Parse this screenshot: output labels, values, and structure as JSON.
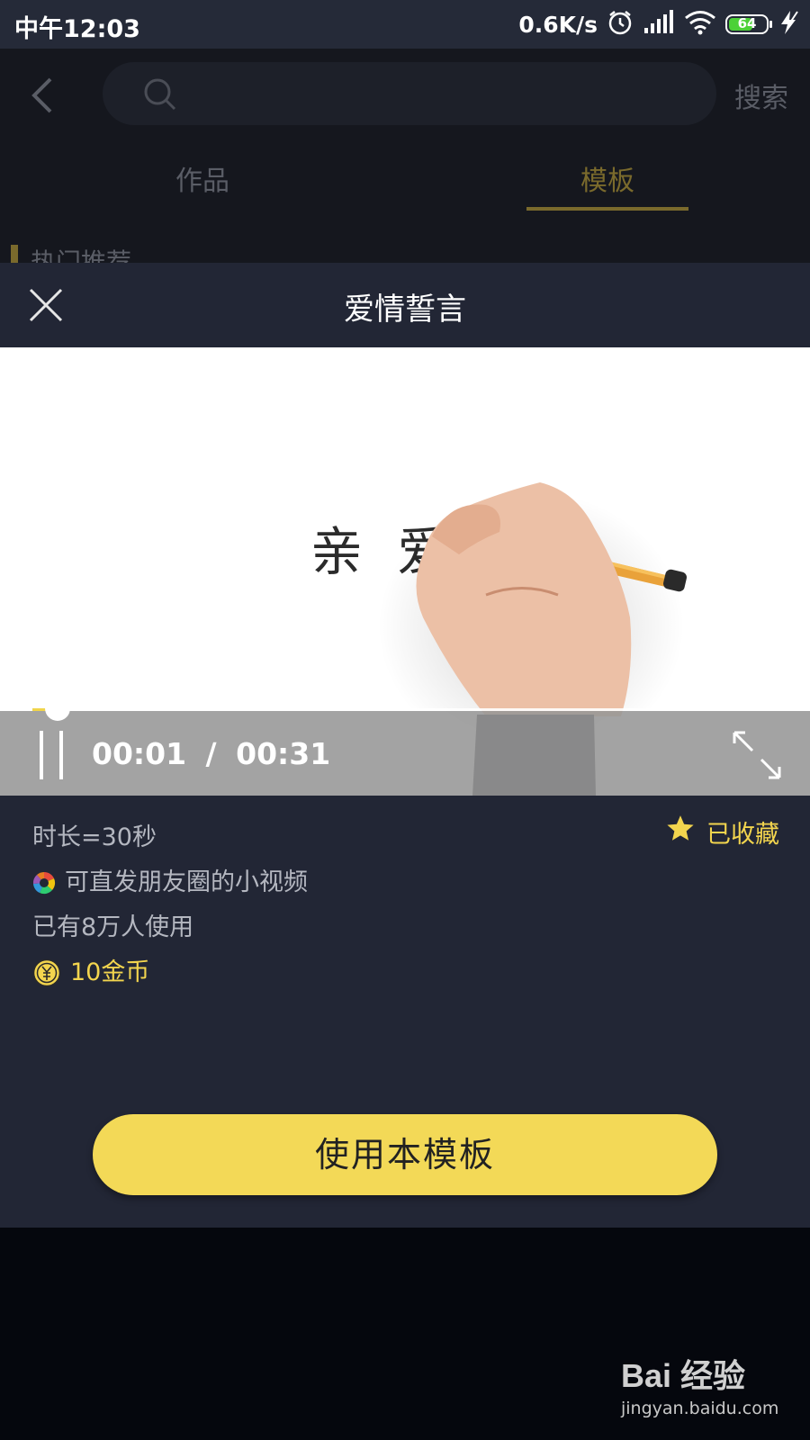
{
  "status_bar": {
    "time": "中午12:03",
    "network_speed": "0.6K/s",
    "battery_level": "64",
    "icons": [
      "alarm-icon",
      "signal-icon",
      "wifi-icon",
      "battery-icon",
      "charging-icon"
    ]
  },
  "background_page": {
    "search_button": "搜索",
    "tabs": [
      {
        "label": "作品",
        "active": false
      },
      {
        "label": "模板",
        "active": true
      }
    ],
    "section_title": "热门推荐"
  },
  "modal": {
    "title": "爱情誓言",
    "video": {
      "frame_text": "亲 爱",
      "current_time": "00:01",
      "separator": "/",
      "total_time": "00:31",
      "progress": 0.032
    },
    "favorite_label": "已收藏",
    "info": {
      "duration": "时长=30秒",
      "moments": "可直发朋友圈的小视频",
      "users": "已有8万人使用",
      "price": "10金币"
    },
    "use_button": "使用本模板"
  },
  "watermark": {
    "logo": "Bai 经验",
    "url": "jingyan.baidu.com"
  },
  "colors": {
    "accent": "#f3d957",
    "modal_bg": "#222635",
    "status_bar_bg": "#252a38",
    "gold_text": "#f3d54e"
  }
}
